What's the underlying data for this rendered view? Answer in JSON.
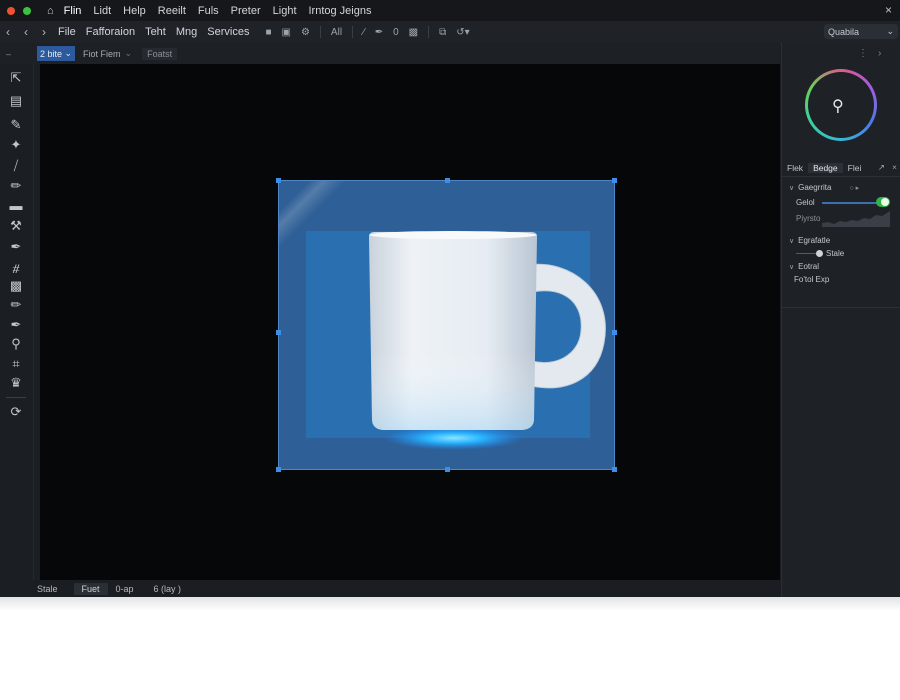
{
  "window": {
    "traffic_colors": [
      "#f0522f",
      "#3cc23e",
      "#e9a42a"
    ],
    "menu": [
      "Flin",
      "Lidt",
      "Help",
      "Reeilt",
      "Fuls",
      "Preter",
      "Light",
      "Irntog Jeigns"
    ],
    "close_label": "×"
  },
  "toolbar": {
    "menu": [
      "File",
      "Fafforaion",
      "Teht",
      "Mng",
      "Services"
    ],
    "icon_labels": [
      "All",
      "0"
    ],
    "quality_label": "Quabila"
  },
  "options_bar": {
    "mode_label": "2 bite",
    "item_label": "Fiot Fiem",
    "box_label": "Foatst"
  },
  "tools": [
    "move-icon",
    "marquee-icon",
    "lasso-icon",
    "magic-wand-icon",
    "crop-icon",
    "eyedropper-icon",
    "heal-icon",
    "brush-icon",
    "stamp-icon",
    "history-brush-icon",
    "eraser-icon",
    "gradient-icon",
    "blur-icon",
    "dodge-icon",
    "pen-icon",
    "type-icon",
    "path-select-icon",
    "shape-icon",
    "rotate-icon"
  ],
  "status": {
    "left": "Stale",
    "tab": "Fuet",
    "mid": "0-ap",
    "right": "6 (lay )"
  },
  "right_panel": {
    "tabs": [
      "Flek",
      "Bedge",
      "Flei"
    ],
    "section1": "Gaegrrita",
    "row1": "Gelol",
    "row2": "Piyrsto",
    "section2": "Egrafatle",
    "scale_label": "Stale",
    "section3": "Eotral",
    "row3": "Fo'tol  Exp"
  },
  "colors": {
    "accent": "#2c5a9c",
    "artboard": "#2e5f96",
    "canvas": "#060709",
    "toggle_on": "#2fb34a"
  }
}
